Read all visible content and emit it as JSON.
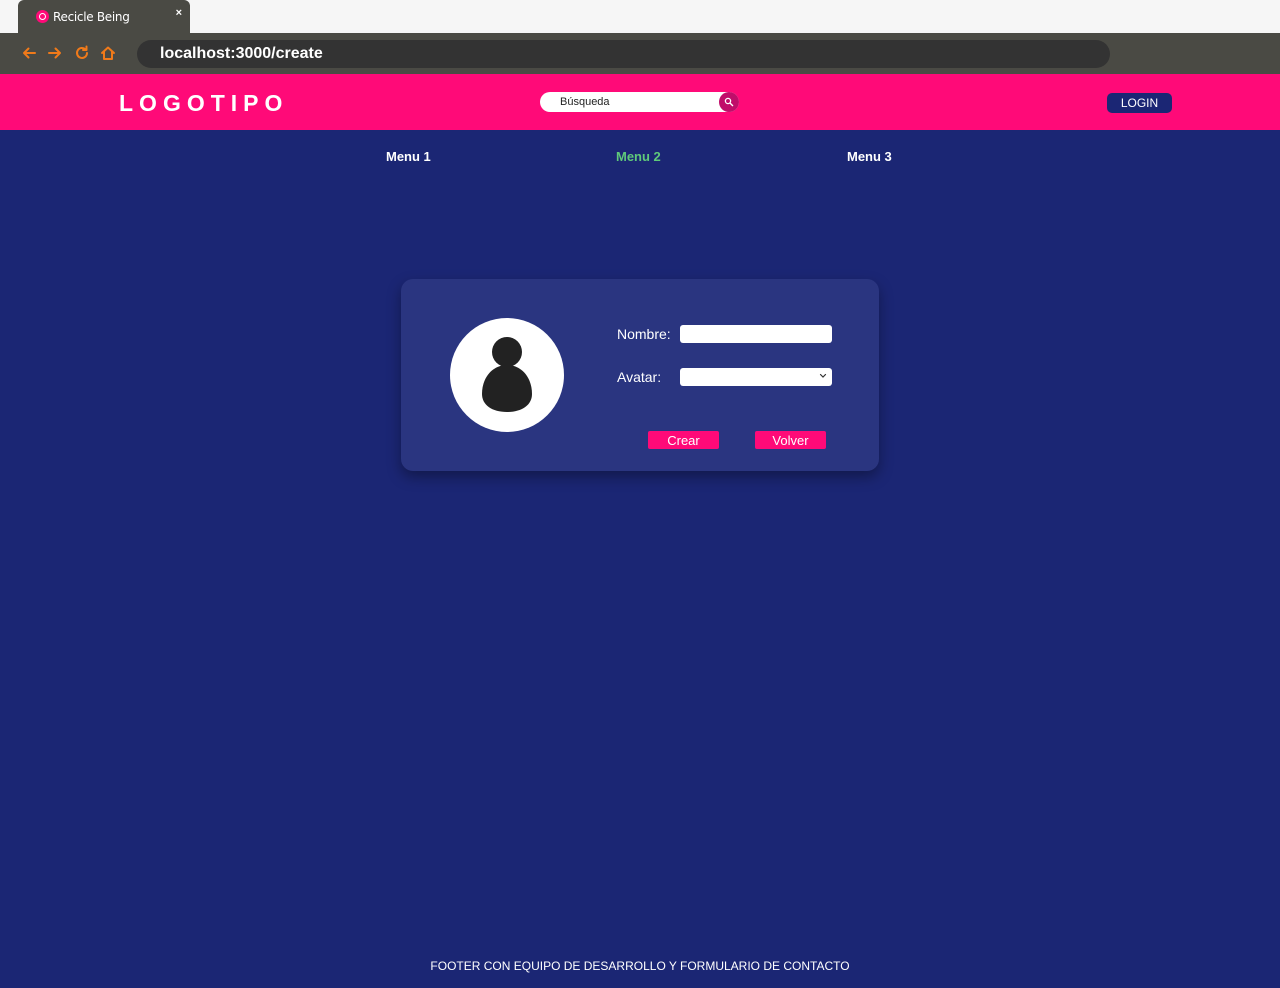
{
  "browser": {
    "tab_title": "Recicle Being",
    "tab_close": "×",
    "url": "localhost:3000/create",
    "accent_color": "#f07a1a",
    "icons": [
      "back-arrow-icon",
      "forward-arrow-icon",
      "reload-icon",
      "home-icon"
    ]
  },
  "header": {
    "logo": "LOGOTIPO",
    "search_placeholder": "Búsqueda",
    "login_label": "LOGIN",
    "background_color": "#ff0a78"
  },
  "menu": {
    "items": [
      {
        "label": "Menu 1"
      },
      {
        "label": "Menu 2",
        "active": true
      },
      {
        "label": "Menu 3"
      }
    ],
    "active_color": "#5fc97a"
  },
  "form": {
    "name_label": "Nombre:",
    "name_value": "",
    "avatar_label": "Avatar:",
    "avatar_selected": "",
    "create_label": "Crear",
    "back_label": "Volver",
    "avatar_icon": "user-silhouette-icon"
  },
  "footer": {
    "text": "FOOTER CON EQUIPO DE DESARROLLO Y FORMULARIO DE CONTACTO"
  },
  "page_background": "#1b2674"
}
